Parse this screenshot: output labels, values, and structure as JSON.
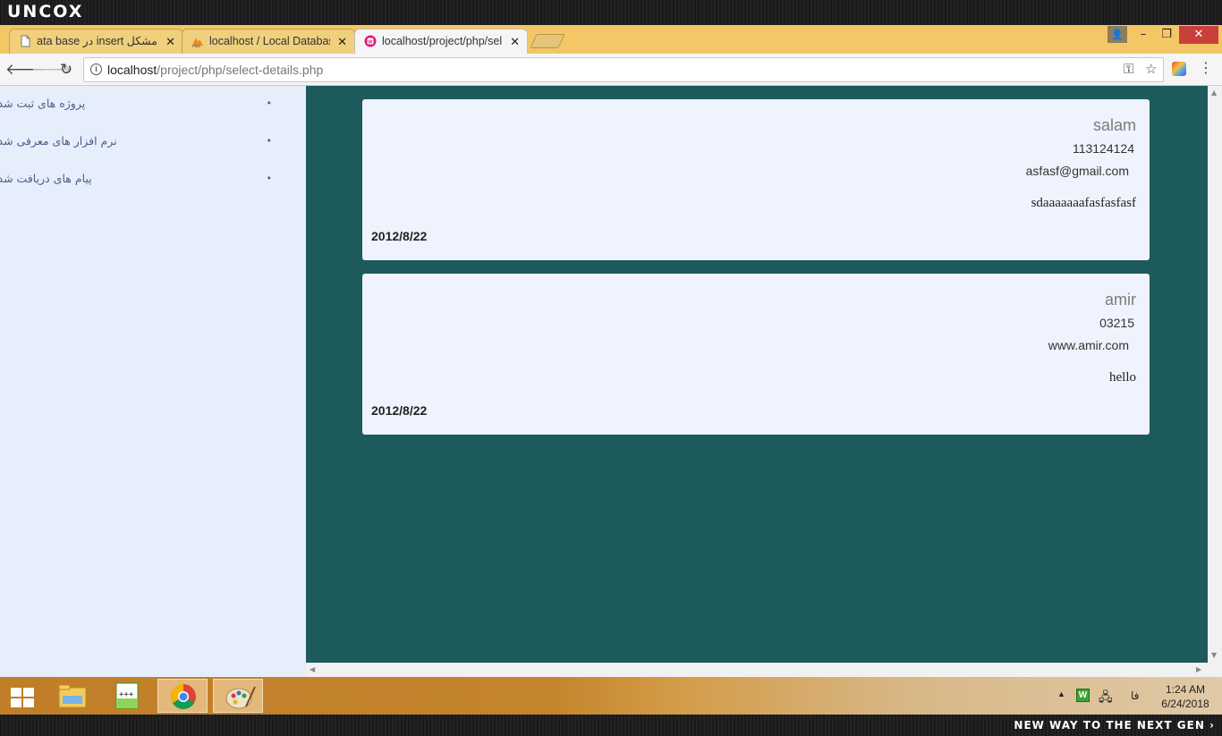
{
  "brand": {
    "logo": "UNCOX",
    "tagline": "NEW WAY TO THE NEXT GEN ›"
  },
  "tabs": [
    {
      "title": "مشکل insert در data base",
      "close": "✕",
      "icon": "page-icon"
    },
    {
      "title": "localhost / Local Databas",
      "close": "✕",
      "icon": "phpmyadmin-icon"
    },
    {
      "title": "localhost/project/php/sel",
      "close": "✕",
      "icon": "wamp-icon",
      "active": true
    }
  ],
  "window_controls": {
    "profile": "👤",
    "minimize": "–",
    "maximize": "❐",
    "close": "✕"
  },
  "address_bar": {
    "host": "localhost",
    "path": "/project/php/select-details.php"
  },
  "sidebar": {
    "items": [
      {
        "label": "پروژه های ثبت شده",
        "bullet": "•"
      },
      {
        "label": "نرم افزار های معرفی شده",
        "bullet": "•"
      },
      {
        "label": "پیام های دریافت شده",
        "bullet": "•"
      }
    ]
  },
  "records": [
    {
      "name": "salam",
      "phone": "113124124",
      "email": "asfasf@gmail.com",
      "message": "sdaaaaaaafasfasfasf",
      "date": "2012/8/22"
    },
    {
      "name": "amir",
      "phone": "03215",
      "email": "www.amir.com",
      "message": "hello",
      "date": "2012/8/22"
    }
  ],
  "taskbar": {
    "apps": [
      "windows-start-icon",
      "file-explorer-icon",
      "notepad-plus-plus-icon",
      "chrome-icon",
      "paint-icon"
    ],
    "language": "فا",
    "time": "1:24 AM",
    "date": "6/24/2018"
  },
  "colors": {
    "tab_strip": "#f3c766",
    "sidebar_bg": "#e6eefc",
    "main_bg": "#1d5a5c",
    "card_bg": "#eef3fd",
    "close_button": "#c9403a"
  }
}
